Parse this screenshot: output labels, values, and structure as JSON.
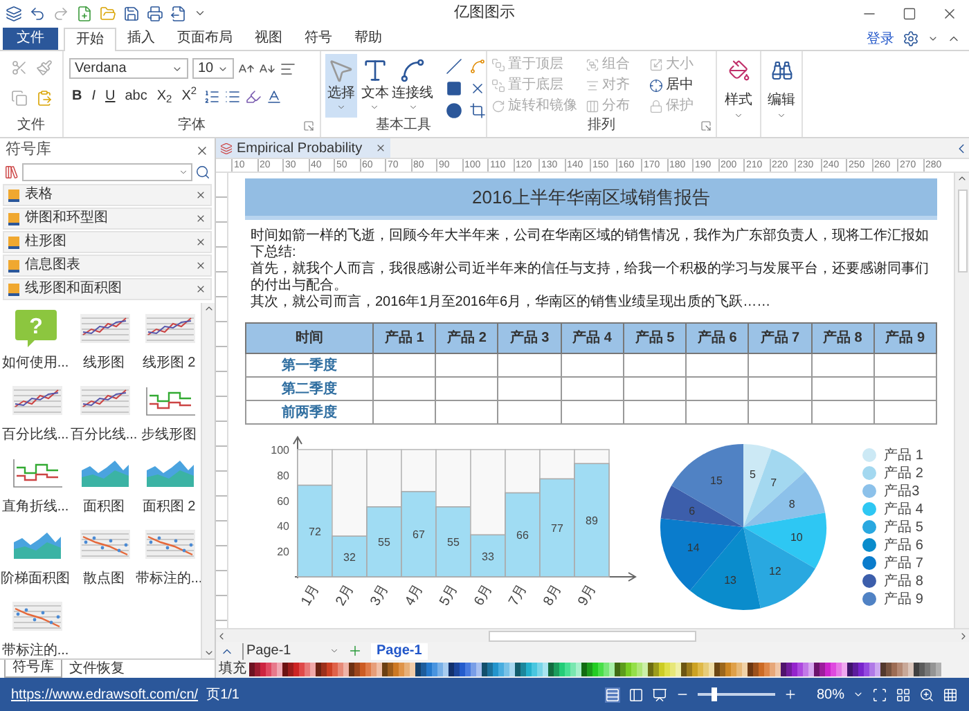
{
  "window": {
    "title": "亿图图示"
  },
  "menu_tabs": [
    {
      "label": "文件",
      "kind": "file",
      "selected": false
    },
    {
      "label": "开始",
      "kind": "tab",
      "selected": true
    },
    {
      "label": "插入",
      "kind": "tab",
      "selected": false
    },
    {
      "label": "页面布局",
      "kind": "tab",
      "selected": false
    },
    {
      "label": "视图",
      "kind": "tab",
      "selected": false
    },
    {
      "label": "符号",
      "kind": "tab",
      "selected": false
    },
    {
      "label": "帮助",
      "kind": "tab",
      "selected": false
    }
  ],
  "account_link": "登录",
  "ribbon": {
    "groups": [
      "文件",
      "字体",
      "基本工具",
      "排列"
    ],
    "font": {
      "family": "Verdana",
      "size": "10",
      "format_buttons": [
        "B",
        "I",
        "U",
        "abc",
        "X$_{2}$",
        "X$^{2}$"
      ]
    },
    "tools": [
      {
        "label": "选择",
        "selected": true
      },
      {
        "label": "文本",
        "selected": false
      },
      {
        "label": "连接线",
        "selected": false
      }
    ],
    "arrange": [
      {
        "label": "置于顶层",
        "disabled": true
      },
      {
        "label": "组合",
        "disabled": true
      },
      {
        "label": "大小",
        "disabled": true
      },
      {
        "label": "置于底层",
        "disabled": true
      },
      {
        "label": "对齐",
        "disabled": true
      },
      {
        "label": "居中",
        "disabled": false
      },
      {
        "label": "旋转和镜像",
        "disabled": true
      },
      {
        "label": "分布",
        "disabled": true
      },
      {
        "label": "保护",
        "disabled": true
      }
    ],
    "style_label": "样式",
    "edit_label": "编辑"
  },
  "library": {
    "title": "符号库",
    "categories": [
      "表格",
      "饼图和环型图",
      "柱形图",
      "信息图表",
      "线形图和面积图"
    ],
    "shapes": [
      {
        "label": "如何使用...",
        "kind": "help",
        "glyph": "?"
      },
      {
        "label": "线形图",
        "kind": "line"
      },
      {
        "label": "线形图 2",
        "kind": "line"
      },
      {
        "label": "百分比线...",
        "kind": "line"
      },
      {
        "label": "百分比线...",
        "kind": "line"
      },
      {
        "label": "步线形图",
        "kind": "step"
      },
      {
        "label": "直角折线...",
        "kind": "step"
      },
      {
        "label": "面积图",
        "kind": "area"
      },
      {
        "label": "面积图 2",
        "kind": "area"
      },
      {
        "label": "阶梯面积图",
        "kind": "area"
      },
      {
        "label": "散点图",
        "kind": "scatter"
      },
      {
        "label": "带标注的...",
        "kind": "scatter"
      },
      {
        "label": "带标注的...",
        "kind": "scatter"
      }
    ],
    "tabs": [
      {
        "label": "符号库",
        "selected": true
      },
      {
        "label": "文件恢复",
        "selected": false
      }
    ]
  },
  "document_tab": "Empirical Probability",
  "ruler": [
    "10",
    "20",
    "30",
    "40",
    "50",
    "60",
    "70",
    "80",
    "90",
    "100",
    "110",
    "120",
    "130",
    "140",
    "150",
    "160",
    "170",
    "180",
    "190",
    "200",
    "210",
    "220",
    "230",
    "240",
    "250",
    "260",
    "270",
    "280"
  ],
  "page": {
    "heading": "2016上半年华南区域销售报告",
    "paragraphs": [
      "时间如箭一样的飞逝，回顾今年大半年来，公司在华南区域的销售情况，我作为广东部负责人，现将工作汇报如下总结:",
      "首先，就我个人而言，我很感谢公司近半年来的信任与支持，给我一个积极的学习与发展平台，还要感谢同事们的付出与配合。",
      "其次，就公司而言，2016年1月至2016年6月，华南区的销售业绩呈现出质的飞跃……"
    ],
    "table": {
      "columns": [
        "时间",
        "产品 1",
        "产品 2",
        "产品 3",
        "产品 4",
        "产品 5",
        "产品 6",
        "产品 7",
        "产品 8",
        "产品 9"
      ],
      "rows": [
        "第一季度",
        "第二季度",
        "前两季度"
      ]
    },
    "bar_chart": {
      "chart_data": {
        "type": "bar",
        "categories": [
          "1月",
          "2月",
          "3月",
          "4月",
          "5月",
          "6月",
          "7月",
          "8月",
          "9月"
        ],
        "values": [
          72,
          32,
          55,
          67,
          55,
          33,
          66,
          77,
          89
        ],
        "ylim": [
          0,
          100
        ],
        "yticks": [
          20,
          40,
          60,
          80,
          100
        ],
        "data_labels": true
      }
    },
    "pie_chart": {
      "chart_data": {
        "type": "pie",
        "categories": [
          "产品 1",
          "产品 2",
          "产品3",
          "产品 4",
          "产品 5",
          "产品 6",
          "产品 7",
          "产品 8",
          "产品 9"
        ],
        "values": [
          5,
          7,
          8,
          10,
          12,
          13,
          14,
          6,
          15
        ],
        "colors": [
          "#cce9f5",
          "#a3d8f0",
          "#8cc1ea",
          "#2ec7f3",
          "#29a8e0",
          "#0a8ccc",
          "#0a7ccc",
          "#3c5eab",
          "#5082c4"
        ],
        "data_labels": true
      }
    }
  },
  "page_bar": {
    "selector": "Page-1",
    "tabs": [
      {
        "label": "Page-1",
        "selected": true
      }
    ]
  },
  "palette_label": "填充",
  "status_bar": {
    "url": "https://www.edrawsoft.com/cn/",
    "page": "页1/1",
    "zoom": {
      "level": 0.22
    },
    "zoom_text": "80%"
  }
}
